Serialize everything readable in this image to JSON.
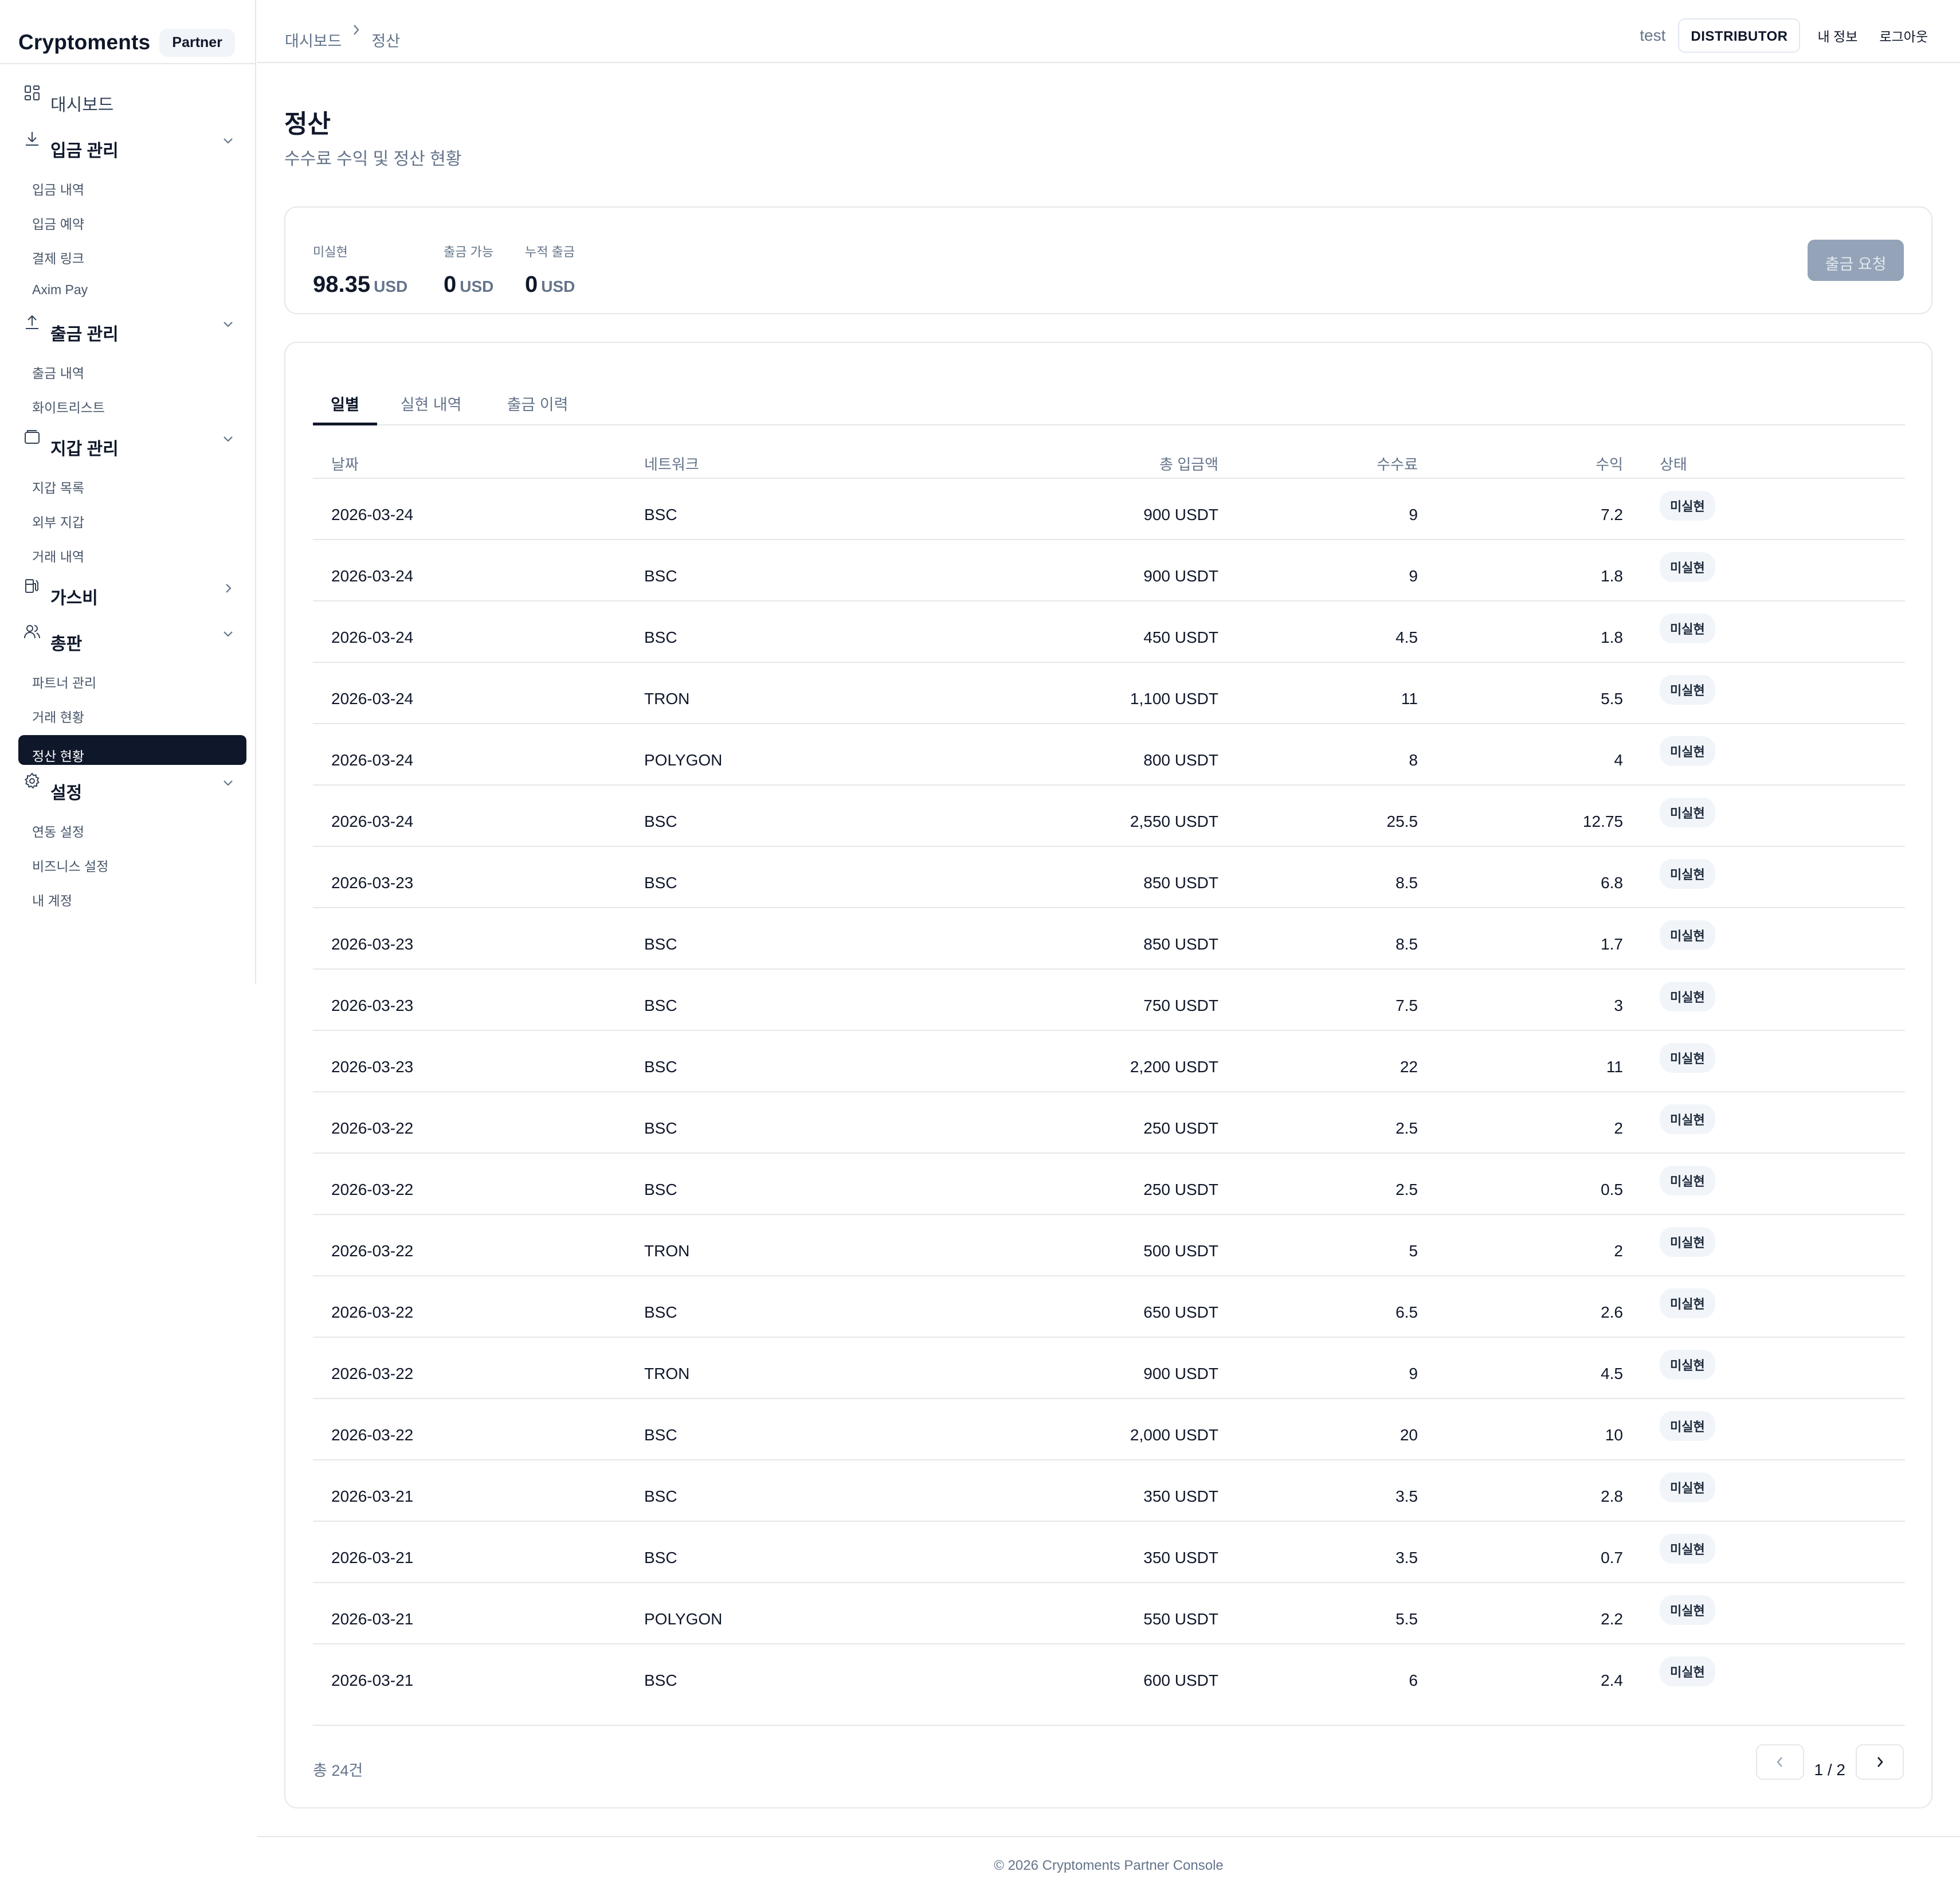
{
  "brand": {
    "name": "Cryptoments",
    "badge": "Partner"
  },
  "sidebar": {
    "groups": [
      {
        "label": "대시보드",
        "icon": "grid-icon",
        "items": []
      },
      {
        "label": "입금 관리",
        "icon": "download-icon",
        "expanded": true,
        "items": [
          "입금 내역",
          "입금 예약",
          "결제 링크",
          "Axim Pay"
        ]
      },
      {
        "label": "출금 관리",
        "icon": "upload-icon",
        "expanded": true,
        "items": [
          "출금 내역",
          "화이트리스트"
        ]
      },
      {
        "label": "지갑 관리",
        "icon": "wallet-icon",
        "expanded": true,
        "items": [
          "지갑 목록",
          "외부 지갑",
          "거래 내역"
        ]
      },
      {
        "label": "가스비",
        "icon": "fuel-icon",
        "expanded": false,
        "items": []
      },
      {
        "label": "총판",
        "icon": "users-icon",
        "expanded": true,
        "items": [
          "파트너 관리",
          "거래 현황",
          "정산 현황"
        ]
      },
      {
        "label": "설정",
        "icon": "gear-icon",
        "expanded": true,
        "items": [
          "연동 설정",
          "비즈니스 설정",
          "내 계정"
        ]
      }
    ],
    "active_item": "정산 현황"
  },
  "header": {
    "breadcrumb": [
      "대시보드",
      "정산"
    ],
    "user": "test",
    "role": "DISTRIBUTOR",
    "my_info": "내 정보",
    "logout": "로그아웃"
  },
  "page": {
    "title": "정산",
    "subtitle": "수수료 수익 및 정산 현황"
  },
  "summary": {
    "stats": [
      {
        "label": "미실현",
        "value": "98.35",
        "unit": "USD"
      },
      {
        "label": "출금 가능",
        "value": "0",
        "unit": "USD"
      },
      {
        "label": "누적 출금",
        "value": "0",
        "unit": "USD"
      }
    ],
    "withdraw_button": "출금 요청"
  },
  "tabs": [
    "일별",
    "실현 내역",
    "출금 이력"
  ],
  "active_tab": "일별",
  "table": {
    "columns": [
      "날짜",
      "네트워크",
      "총 입금액",
      "수수료",
      "수익",
      "상태"
    ],
    "rows": [
      [
        "2026-03-24",
        "BSC",
        "900",
        "USDT",
        "9",
        "7.2",
        "미실현"
      ],
      [
        "2026-03-24",
        "BSC",
        "900",
        "USDT",
        "9",
        "1.8",
        "미실현"
      ],
      [
        "2026-03-24",
        "BSC",
        "450",
        "USDT",
        "4.5",
        "1.8",
        "미실현"
      ],
      [
        "2026-03-24",
        "TRON",
        "1,100",
        "USDT",
        "11",
        "5.5",
        "미실현"
      ],
      [
        "2026-03-24",
        "POLYGON",
        "800",
        "USDT",
        "8",
        "4",
        "미실현"
      ],
      [
        "2026-03-24",
        "BSC",
        "2,550",
        "USDT",
        "25.5",
        "12.75",
        "미실현"
      ],
      [
        "2026-03-23",
        "BSC",
        "850",
        "USDT",
        "8.5",
        "6.8",
        "미실현"
      ],
      [
        "2026-03-23",
        "BSC",
        "850",
        "USDT",
        "8.5",
        "1.7",
        "미실현"
      ],
      [
        "2026-03-23",
        "BSC",
        "750",
        "USDT",
        "7.5",
        "3",
        "미실현"
      ],
      [
        "2026-03-23",
        "BSC",
        "2,200",
        "USDT",
        "22",
        "11",
        "미실현"
      ],
      [
        "2026-03-22",
        "BSC",
        "250",
        "USDT",
        "2.5",
        "2",
        "미실현"
      ],
      [
        "2026-03-22",
        "BSC",
        "250",
        "USDT",
        "2.5",
        "0.5",
        "미실현"
      ],
      [
        "2026-03-22",
        "TRON",
        "500",
        "USDT",
        "5",
        "2",
        "미실현"
      ],
      [
        "2026-03-22",
        "BSC",
        "650",
        "USDT",
        "6.5",
        "2.6",
        "미실현"
      ],
      [
        "2026-03-22",
        "TRON",
        "900",
        "USDT",
        "9",
        "4.5",
        "미실현"
      ],
      [
        "2026-03-22",
        "BSC",
        "2,000",
        "USDT",
        "20",
        "10",
        "미실현"
      ],
      [
        "2026-03-21",
        "BSC",
        "350",
        "USDT",
        "3.5",
        "2.8",
        "미실현"
      ],
      [
        "2026-03-21",
        "BSC",
        "350",
        "USDT",
        "3.5",
        "0.7",
        "미실현"
      ],
      [
        "2026-03-21",
        "POLYGON",
        "550",
        "USDT",
        "5.5",
        "2.2",
        "미실현"
      ],
      [
        "2026-03-21",
        "BSC",
        "600",
        "USDT",
        "6",
        "2.4",
        "미실현"
      ]
    ],
    "total": "총 24건",
    "page_info": "1 / 2"
  },
  "footer": "© 2026 Cryptoments Partner Console"
}
